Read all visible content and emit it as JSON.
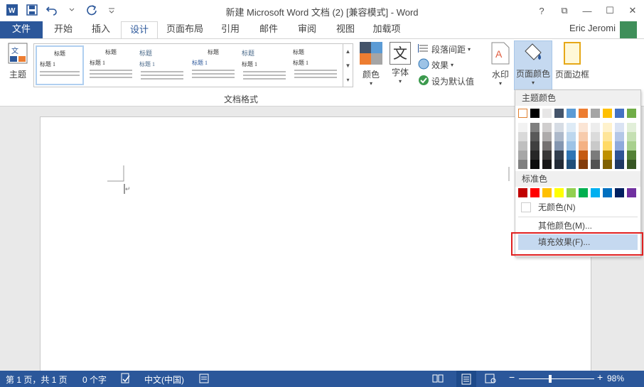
{
  "title": "新建 Microsoft Word 文档 (2) [兼容模式] - Word",
  "qat": {
    "icons": [
      "word-logo",
      "save",
      "undo",
      "redo",
      "customize"
    ]
  },
  "window": {
    "help": "?",
    "restore": "⧉",
    "minimize": "—",
    "maximize": "☐",
    "close": "✕"
  },
  "tabs": [
    "文件",
    "开始",
    "插入",
    "设计",
    "页面布局",
    "引用",
    "邮件",
    "审阅",
    "视图",
    "加载项"
  ],
  "active_tab": "设计",
  "user": "Eric Jeromi",
  "ribbon": {
    "theme_label": "主题",
    "gallery_title": "标题",
    "gallery_heading1": "标题 1",
    "group_label": "文档格式",
    "colors_label": "颜色",
    "fonts_label": "字体",
    "fonts_glyph": "文",
    "paragraph_spacing": "段落间距",
    "effects": "效果",
    "set_default": "设为默认值",
    "watermark": "水印",
    "page_color": "页面颜色",
    "page_border": "页面边框"
  },
  "dropdown": {
    "theme_colors_header": "主题颜色",
    "standard_colors_header": "标准色",
    "no_color": "无颜色(N)",
    "more_colors": "其他颜色(M)...",
    "fill_effects": "填充效果(F)...",
    "theme_colors": [
      "#ffffff",
      "#000000",
      "#e7e6e6",
      "#44546a",
      "#5b9bd5",
      "#ed7d31",
      "#a5a5a5",
      "#ffc000",
      "#4472c4",
      "#70ad47"
    ],
    "shade_columns": [
      [
        "#f2f2f2",
        "#d9d9d9",
        "#bfbfbf",
        "#a6a6a6",
        "#808080"
      ],
      [
        "#7f7f7f",
        "#595959",
        "#404040",
        "#262626",
        "#0d0d0d"
      ],
      [
        "#d0cece",
        "#aeabab",
        "#757171",
        "#3a3838",
        "#171616"
      ],
      [
        "#d6dce4",
        "#adb9ca",
        "#8496b0",
        "#323f4f",
        "#222a35"
      ],
      [
        "#deebf6",
        "#bdd7ee",
        "#9dc3e6",
        "#2e75b5",
        "#1f4e79"
      ],
      [
        "#fbe5d5",
        "#f7cbac",
        "#f4b183",
        "#c55a11",
        "#833c0b"
      ],
      [
        "#ededed",
        "#dbdbdb",
        "#c9c9c9",
        "#7b7b7b",
        "#525252"
      ],
      [
        "#fff2cc",
        "#fee599",
        "#ffd965",
        "#bf9000",
        "#7f6000"
      ],
      [
        "#dae3f3",
        "#b4c7e7",
        "#8faadc",
        "#2f5496",
        "#1f3864"
      ],
      [
        "#e2efd9",
        "#c5e0b3",
        "#a8d08d",
        "#538135",
        "#375623"
      ]
    ],
    "standard_colors": [
      "#c00000",
      "#ff0000",
      "#ffc000",
      "#ffff00",
      "#92d050",
      "#00b050",
      "#00b0f0",
      "#0070c0",
      "#002060",
      "#7030a0"
    ]
  },
  "status": {
    "page": "第 1 页，共 1 页",
    "words": "0 个字",
    "language": "中文(中国)",
    "zoom": "98%",
    "zoom_minus": "−",
    "zoom_plus": "+"
  },
  "colors": {
    "accent": "#2b579a",
    "highlight": "#e02020"
  }
}
